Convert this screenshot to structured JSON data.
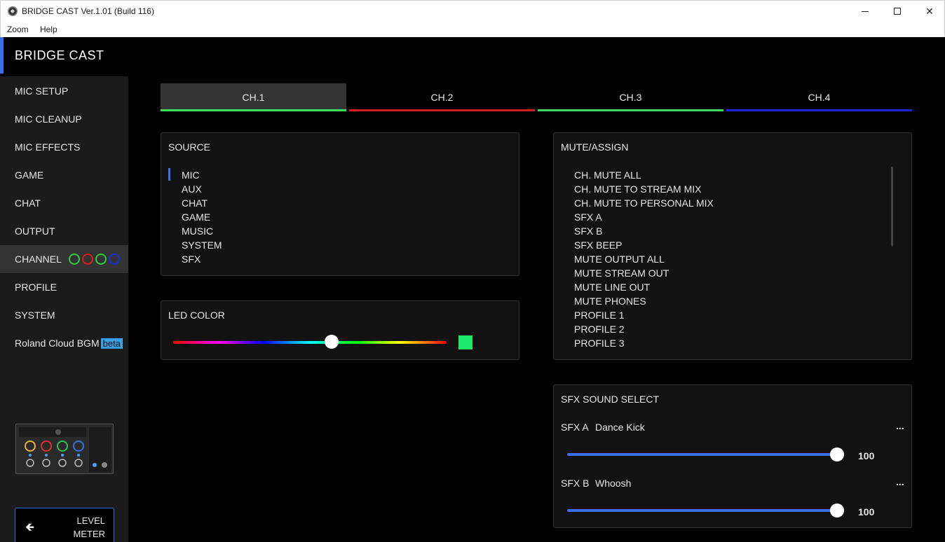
{
  "window": {
    "title": "BRIDGE CAST Ver.1.01 (Build 116)",
    "minimize_icon": "minimize-icon",
    "maximize_icon": "maximize-icon",
    "close_glyph": "✕"
  },
  "menu": {
    "zoom": "Zoom",
    "help": "Help"
  },
  "app": {
    "title": "BRIDGE CAST",
    "accent_color": "#3c6ee8"
  },
  "sidebar": {
    "items": [
      {
        "label": "MIC SETUP"
      },
      {
        "label": "MIC CLEANUP"
      },
      {
        "label": "MIC EFFECTS"
      },
      {
        "label": "GAME"
      },
      {
        "label": "CHAT"
      },
      {
        "label": "OUTPUT"
      },
      {
        "label": "CHANNEL",
        "active": true
      },
      {
        "label": "PROFILE"
      },
      {
        "label": "SYSTEM"
      },
      {
        "label": "Roland Cloud BGM",
        "badge": "beta"
      }
    ],
    "channel_colors": [
      "#2ecc40",
      "#e01b1b",
      "#2ecc40",
      "#1a2ad8"
    ],
    "level_meter": {
      "icon": "arrow-left-icon",
      "label": "LEVEL\nMETER"
    }
  },
  "tabs": [
    {
      "label": "CH.1",
      "color": "#3ddc5a",
      "active": true
    },
    {
      "label": "CH.2",
      "color": "#d21f1f"
    },
    {
      "label": "CH.3",
      "color": "#3ddc5a"
    },
    {
      "label": "CH.4",
      "color": "#1a2ad8"
    }
  ],
  "source": {
    "title": "SOURCE",
    "selected": "MIC",
    "items": [
      "MIC",
      "AUX",
      "CHAT",
      "GAME",
      "MUSIC",
      "SYSTEM",
      "SFX"
    ]
  },
  "led_color": {
    "title": "LED COLOR",
    "hue_fraction": 0.58,
    "swatch_color": "#1ee86a"
  },
  "mute_assign": {
    "title": "MUTE/ASSIGN",
    "items": [
      "CH. MUTE ALL",
      "CH. MUTE TO STREAM MIX",
      "CH. MUTE TO PERSONAL MIX",
      "SFX A",
      "SFX B",
      "SFX BEEP",
      "MUTE OUTPUT ALL",
      "MUTE STREAM OUT",
      "MUTE LINE OUT",
      "MUTE PHONES",
      "PROFILE 1",
      "PROFILE 2",
      "PROFILE 3"
    ]
  },
  "sfx_sound_select": {
    "title": "SFX SOUND SELECT",
    "rows": [
      {
        "label": "SFX A",
        "sound": "Dance Kick",
        "more": "...",
        "volume": "100",
        "level": 1.0
      },
      {
        "label": "SFX B",
        "sound": "Whoosh",
        "more": "...",
        "volume": "100",
        "level": 1.0
      }
    ]
  }
}
